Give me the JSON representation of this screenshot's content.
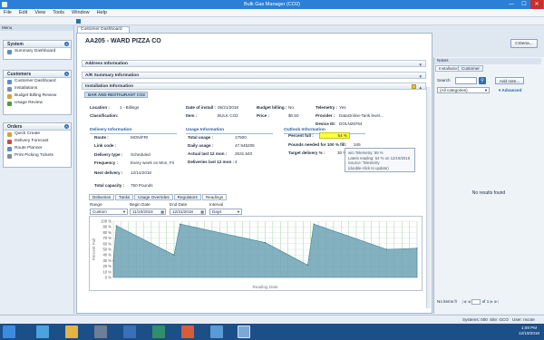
{
  "window": {
    "title": "Bulk Gas Manager (CO2)",
    "minimize_label": "—",
    "maximize_label": "☐",
    "close_label": "✕"
  },
  "menu": [
    "File",
    "Edit",
    "View",
    "Tools",
    "Window",
    "Help"
  ],
  "left": {
    "menu_label": "Menu",
    "system": {
      "title": "System",
      "items": [
        "Summary Dashboard"
      ]
    },
    "customers": {
      "title": "Customers",
      "items": [
        "Customer Dashboard",
        "Installations",
        "Budget Billing Review",
        "Usage Review"
      ]
    },
    "orders": {
      "title": "Orders",
      "items": [
        "Quick Create",
        "Delivery Forecast",
        "Route Planner",
        "Print Picking Tickets"
      ]
    }
  },
  "doc_tab": "Customer Dashboard",
  "customer": {
    "title": "AA205 - WARD PIZZA CO",
    "criteria_button": "Criteria..."
  },
  "bands": {
    "address": "Address Information",
    "ar": "A/R Summary Information",
    "installation": "Installation Information"
  },
  "install_tab": "BAR AND RESTAURANT CO2",
  "info": {
    "location_label": "Location :",
    "location": "1 - Billings",
    "classification_label": "Classification:",
    "date_install_label": "Date of install :",
    "date_install": "05/21/2018",
    "item_label": "Item :",
    "item": "BULK CO2",
    "budget_label": "Budget billing :",
    "budget": "No",
    "price_label": "Price :",
    "price": "$0.50",
    "telemetry_label": "Telemetry :",
    "telemetry": "Yes",
    "provider_label": "Provider :",
    "provider": "DataOnline-Tank level...",
    "device_label": "Device ID:",
    "device": "DOLN28764"
  },
  "delivery": {
    "title": "Delivery Information",
    "route_label": "Route :",
    "route": "MON/FRI",
    "link_label": "Link code :",
    "type_label": "Delivery type :",
    "type": "Scheduled",
    "freq_label": "Frequency :",
    "freq": "Every week on Mon, Fri",
    "next_label": "Next delivery :",
    "next": "12/14/2018",
    "capacity_label": "Total capacity :",
    "capacity": "750 Pounds"
  },
  "usage": {
    "title": "Usage Information",
    "total_label": "Total usage :",
    "total": "17500",
    "daily_label": "Daily usage :",
    "daily": "47.945205",
    "actual_label": "Actual last 12 mon :",
    "actual": "2631.640",
    "deliv_label": "Deliveries last 12 mon :",
    "deliv": "4"
  },
  "outlook": {
    "title": "Outlook Information",
    "pct_label": "Percent full :",
    "pct": "54 %",
    "pounds_label": "Pounds needed for 100 % fill:",
    "pounds": "345",
    "target_label": "Target delivery % :",
    "target": "30 %",
    "tooltip": [
      "w/o Telemetry: 55 %",
      "Latest reading: 54 % on 12/19/2018",
      "Source: Telemetry",
      "(double-click to update)"
    ]
  },
  "subtabs": [
    "Deliveries",
    "Tanks",
    "Usage Overrides",
    "Regulators",
    "Readings"
  ],
  "filters": {
    "range_label": "Range",
    "range": "Custom",
    "begin_label": "Begin Date",
    "begin": "11/10/2018",
    "end_label": "End Date",
    "end": "12/31/2018",
    "interval_label": "Interval",
    "interval": "Days"
  },
  "chart_data": {
    "type": "area",
    "ylabel": "Percent Full",
    "xlabel": "Reading Date",
    "y_ticks": [
      "100 %",
      "90 %",
      "80 %",
      "70 %",
      "60 %",
      "50 %",
      "40 %",
      "30 %",
      "20 %",
      "10 %",
      "0 %"
    ],
    "ylim": [
      0,
      100
    ],
    "x": [
      0,
      0.01,
      0.2,
      0.22,
      0.5,
      0.64,
      0.66,
      0.9,
      1.0
    ],
    "values": [
      30,
      92,
      40,
      95,
      62,
      22,
      95,
      50,
      52
    ],
    "fill_color": "#6fa3b5"
  },
  "right": {
    "notes_label": "Notes",
    "tabs": [
      "Installation",
      "Customer"
    ],
    "search_label": "Search",
    "add_note": "Add note...",
    "category": "(All categories)",
    "advanced": "Advanced",
    "no_results": "No results found",
    "items_label": "No items fr",
    "page_of": "of 1"
  },
  "status": {
    "sys": "Systems: 000",
    "site": "Site: GCO",
    "user": "User: mcote"
  },
  "clock": {
    "time": "1:08 PM",
    "date": "12/19/2018"
  }
}
